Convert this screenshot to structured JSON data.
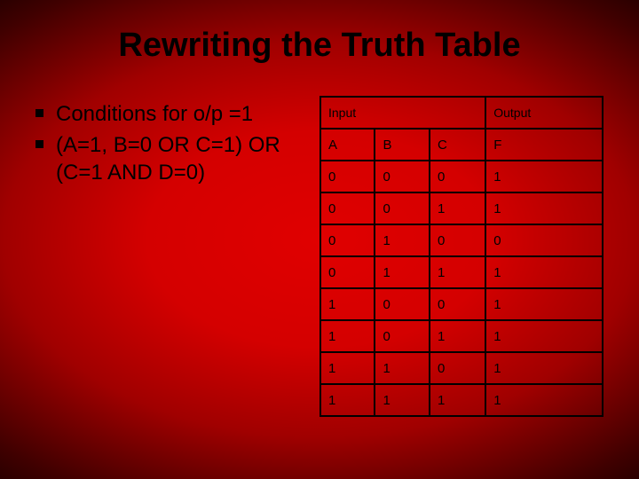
{
  "title": "Rewriting the Truth Table",
  "bullets": [
    "Conditions for o/p =1",
    "(A=1, B=0 OR C=1) OR (C=1 AND D=0)"
  ],
  "table": {
    "group_headers": {
      "input": "Input",
      "output": "Output"
    },
    "headers": [
      "A",
      "B",
      "C",
      "F"
    ],
    "rows": [
      [
        "0",
        "0",
        "0",
        "1"
      ],
      [
        "0",
        "0",
        "1",
        "1"
      ],
      [
        "0",
        "1",
        "0",
        "0"
      ],
      [
        "0",
        "1",
        "1",
        "1"
      ],
      [
        "1",
        "0",
        "0",
        "1"
      ],
      [
        "1",
        "0",
        "1",
        "1"
      ],
      [
        "1",
        "1",
        "0",
        "1"
      ],
      [
        "1",
        "1",
        "1",
        "1"
      ]
    ]
  },
  "chart_data": {
    "type": "table",
    "title": "Rewriting the Truth Table",
    "group_headers": [
      "Input",
      "Input",
      "Input",
      "Output"
    ],
    "columns": [
      "A",
      "B",
      "C",
      "F"
    ],
    "rows": [
      [
        0,
        0,
        0,
        1
      ],
      [
        0,
        0,
        1,
        1
      ],
      [
        0,
        1,
        0,
        0
      ],
      [
        0,
        1,
        1,
        1
      ],
      [
        1,
        0,
        0,
        1
      ],
      [
        1,
        0,
        1,
        1
      ],
      [
        1,
        1,
        0,
        1
      ],
      [
        1,
        1,
        1,
        1
      ]
    ]
  }
}
